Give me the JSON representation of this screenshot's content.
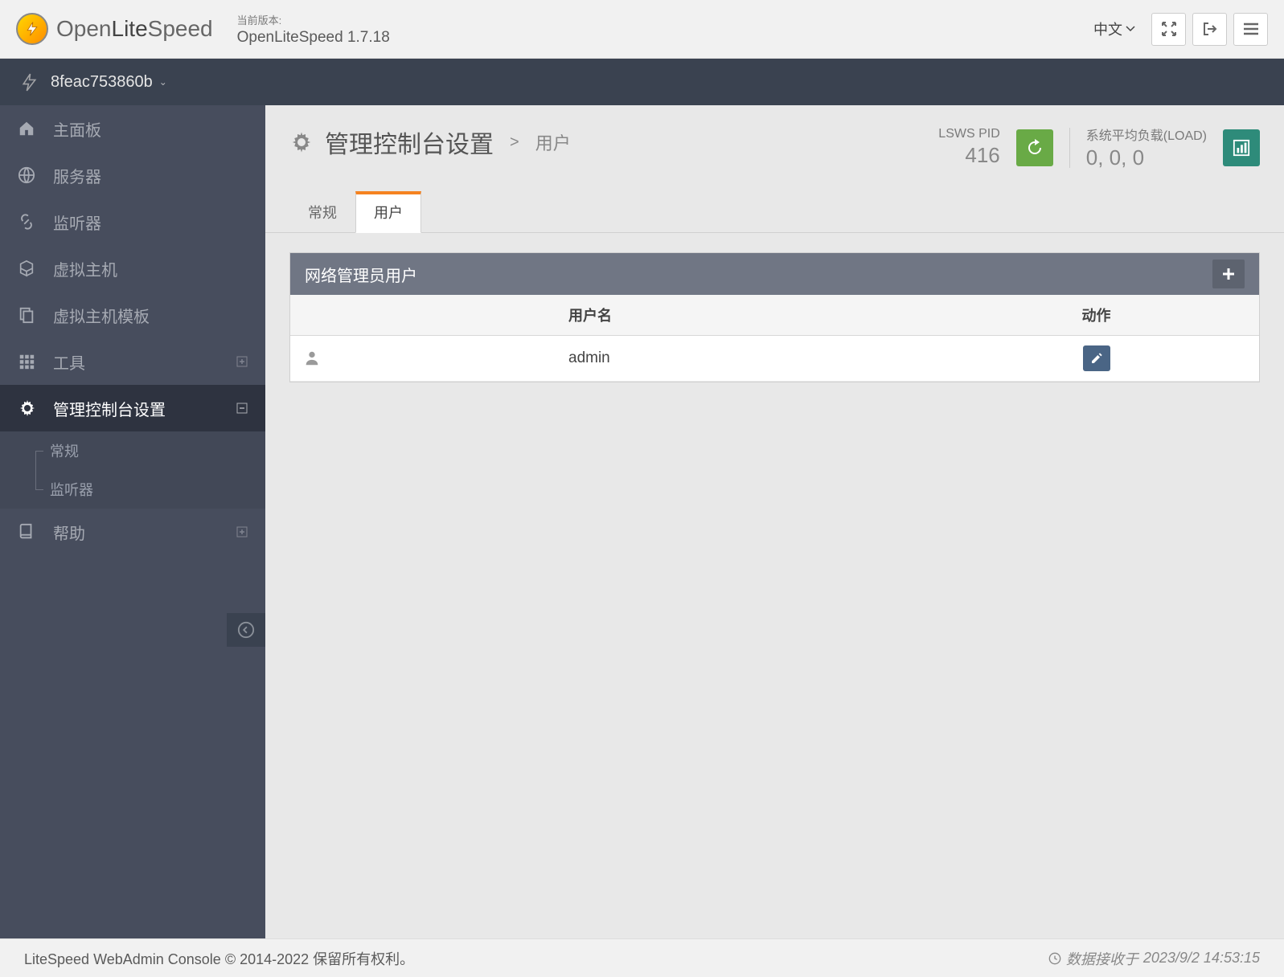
{
  "header": {
    "logo_text_light": "Open",
    "logo_text_bold": "Lite",
    "logo_text_light2": "Speed",
    "version_label": "当前版本:",
    "version_value": "OpenLiteSpeed 1.7.18",
    "language": "中文"
  },
  "server": {
    "name": "8feac753860b"
  },
  "sidebar": {
    "items": [
      {
        "label": "主面板",
        "icon": "home"
      },
      {
        "label": "服务器",
        "icon": "globe"
      },
      {
        "label": "监听器",
        "icon": "link"
      },
      {
        "label": "虚拟主机",
        "icon": "cubes"
      },
      {
        "label": "虚拟主机模板",
        "icon": "copy"
      },
      {
        "label": "工具",
        "icon": "grid",
        "expand": "plus"
      },
      {
        "label": "管理控制台设置",
        "icon": "cog",
        "expand": "minus",
        "active": true
      },
      {
        "label": "帮助",
        "icon": "book",
        "expand": "plus"
      }
    ],
    "sub": [
      {
        "label": "常规"
      },
      {
        "label": "监听器"
      }
    ]
  },
  "page": {
    "title": "管理控制台设置",
    "breadcrumb_current": "用户",
    "pid_label": "LSWS PID",
    "pid_value": "416",
    "load_label": "系统平均负载(LOAD)",
    "load_value": "0, 0, 0"
  },
  "tabs": [
    {
      "label": "常规"
    },
    {
      "label": "用户",
      "active": true
    }
  ],
  "panel": {
    "title": "网络管理员用户",
    "columns": {
      "user": "用户名",
      "action": "动作"
    },
    "rows": [
      {
        "username": "admin"
      }
    ]
  },
  "footer": {
    "copyright": "LiteSpeed WebAdmin Console © 2014-2022 保留所有权利。",
    "data_prefix": "数据接收于",
    "data_time": "2023/9/2 14:53:15"
  }
}
